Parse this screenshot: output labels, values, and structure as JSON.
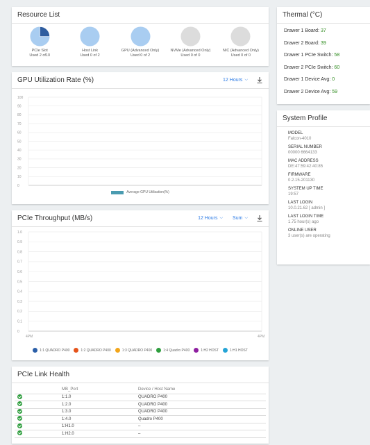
{
  "resource_list": {
    "title": "Resource List",
    "items": [
      {
        "name": "PCIe Slot",
        "used": "Used 2 of10",
        "fraction": 0.2
      },
      {
        "name": "Host Link",
        "used": "Used 0 of 2",
        "fraction": 0
      },
      {
        "name": "GPU (Advanced Only)",
        "used": "Used 0 of 2",
        "fraction": 0
      },
      {
        "name": "NVMe (Advanced Only)",
        "used": "Used 0 of 0",
        "fraction": 0
      },
      {
        "name": "NIC (Advanced Only)",
        "used": "Used 0 of 0",
        "fraction": 0
      }
    ],
    "colors": {
      "used": "#2f5d9f",
      "free_active": "#a9cdf1",
      "empty": "#dcdcdc"
    }
  },
  "gpu_chart": {
    "title": "GPU Utilization Rate (%)",
    "range_label": "12 Hours",
    "download_icon": "download-icon",
    "legend": "Average GPU Utilization(%)",
    "legend_color": "#4a9bb0"
  },
  "pcie_chart": {
    "title": "PCIe Throughput (MB/s)",
    "range_label": "12 Hours",
    "agg_label": "Sum",
    "download_icon": "download-icon",
    "x_start": "4PM",
    "x_end": "4PM",
    "legend": [
      {
        "label": "1:1 QUADRO P400",
        "color": "#2b5fa8"
      },
      {
        "label": "1:2 QUADRO P400",
        "color": "#e5531a"
      },
      {
        "label": "1:3 QUADRO P400",
        "color": "#f2a51a"
      },
      {
        "label": "1:4 Quadro P400",
        "color": "#2e9e3e"
      },
      {
        "label": "1:H2 HOST",
        "color": "#8e1fa0"
      },
      {
        "label": "1:H1 HOST",
        "color": "#25a4d6"
      }
    ]
  },
  "chart_data": [
    {
      "type": "line",
      "title": "GPU Utilization Rate (%)",
      "xlabel": "",
      "ylabel": "",
      "ylim": [
        0,
        100
      ],
      "yticks": [
        "100",
        "90",
        "80",
        "70",
        "60",
        "50",
        "40",
        "30",
        "20",
        "10",
        "0"
      ],
      "series": [
        {
          "name": "Average GPU Utilization(%)",
          "values": []
        }
      ],
      "grid": true,
      "legend_position": "bottom"
    },
    {
      "type": "line",
      "title": "PCIe Throughput (MB/s)",
      "xlabel": "",
      "ylabel": "",
      "ylim": [
        0,
        1.0
      ],
      "yticks": [
        "1.0",
        "0.9",
        "0.8",
        "0.7",
        "0.6",
        "0.5",
        "0.4",
        "0.3",
        "0.2",
        "0.1",
        "0"
      ],
      "x": [
        "4PM",
        "4PM"
      ],
      "series": [
        {
          "name": "1:1 QUADRO P400",
          "values": []
        },
        {
          "name": "1:2 QUADRO P400",
          "values": []
        },
        {
          "name": "1:3 QUADRO P400",
          "values": []
        },
        {
          "name": "1:4 Quadro P400",
          "values": []
        },
        {
          "name": "1:H2 HOST",
          "values": []
        },
        {
          "name": "1:H1 HOST",
          "values": []
        }
      ],
      "grid": true,
      "legend_position": "bottom"
    }
  ],
  "link_health": {
    "title": "PCIe Link Health",
    "columns": [
      "MB_Port",
      "Device / Host Name"
    ],
    "rows": [
      {
        "port": "1:1.0",
        "device": "QUADRO P400"
      },
      {
        "port": "1:2.0",
        "device": "QUADRO P400"
      },
      {
        "port": "1:3.0",
        "device": "QUADRO P400"
      },
      {
        "port": "1:4.0",
        "device": "Quadro P400"
      },
      {
        "port": "1:H1.0",
        "device": "–"
      },
      {
        "port": "1:H2.0",
        "device": "–"
      }
    ],
    "status_icon": "check-circle-icon",
    "status_color": "#2e9e3e"
  },
  "thermal": {
    "title": "Thermal (°C)",
    "rows": [
      {
        "label": "Drawer 1 Board:",
        "value": "37"
      },
      {
        "label": "Drawer 2 Board:",
        "value": "39"
      },
      {
        "label": "Drawer 1 PCIe Switch:",
        "value": "58"
      },
      {
        "label": "Drawer 2 PCIe Switch:",
        "value": "60"
      },
      {
        "label": "Drawer 1 Device Avg:",
        "value": "0"
      },
      {
        "label": "Drawer 2 Device Avg:",
        "value": "59"
      }
    ],
    "value_color": "#2e8b1e"
  },
  "system_profile": {
    "title": "System Profile",
    "items": [
      {
        "label": "MODEL",
        "value": "Falcon-4010"
      },
      {
        "label": "SERIAL NUMBER",
        "value": "00000 6664133"
      },
      {
        "label": "MAC ADDRESS",
        "value": "DE:47:59:42:40:85"
      },
      {
        "label": "FIRMWARE",
        "value": "0.2.15-201130"
      },
      {
        "label": "SYSTEM UP TIME",
        "value": "19:57"
      },
      {
        "label": "LAST LOGIN",
        "value": "10.0.21.62 [ admin ]"
      },
      {
        "label": "LAST LOGIN TIME",
        "value": "1.75 hour(s) ago"
      },
      {
        "label": "ONLINE USER",
        "value": "3 user(s) are operating"
      }
    ]
  }
}
